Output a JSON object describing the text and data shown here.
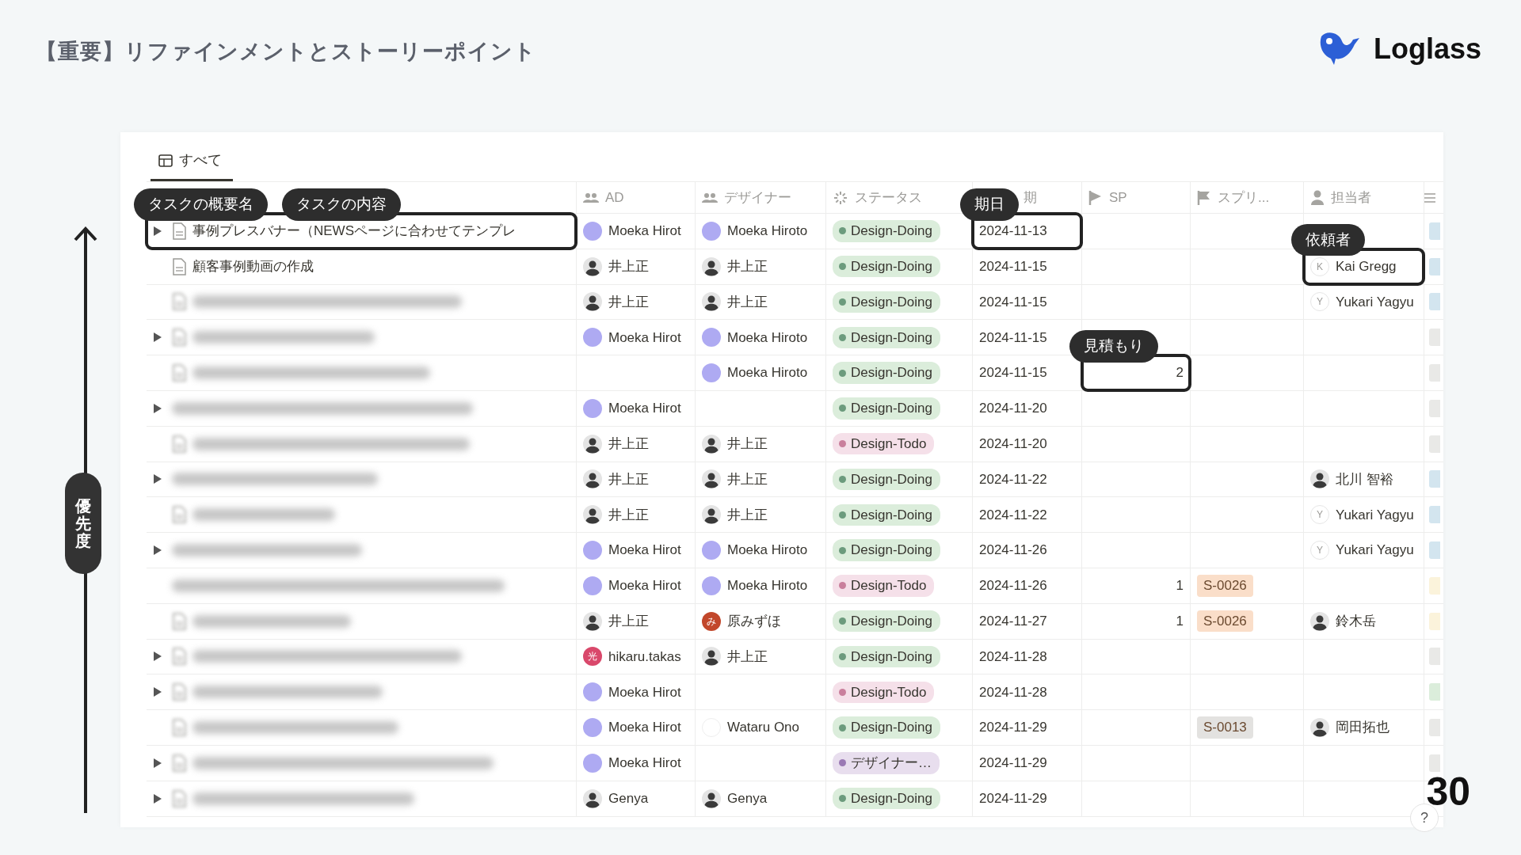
{
  "slide": {
    "title": "【重要】リファインメントとストーリーポイント",
    "brand": "Loglass",
    "page_number": "30"
  },
  "side_axis": {
    "label": "優先度"
  },
  "view_tab": {
    "label": "すべて",
    "selected": true
  },
  "help_button": {
    "label": "?"
  },
  "columns": [
    {
      "label": "AD"
    },
    {
      "label": "デザイナー"
    },
    {
      "label": "ステータス"
    },
    {
      "label": "期"
    },
    {
      "label": "SP"
    },
    {
      "label": "スプリ..."
    },
    {
      "label": "担当者"
    }
  ],
  "rows": [
    {
      "expandable": true,
      "page_icon": true,
      "name": "事例プレスバナー（NEWSページに合わせてテンプレ",
      "ad": {
        "name": "Moeka Hirot",
        "avatar": {
          "kind": "circle",
          "color": "#aeaaf2"
        }
      },
      "designer": {
        "name": "Moeka Hiroto",
        "avatar": {
          "kind": "circle",
          "color": "#aeaaf2"
        }
      },
      "status": {
        "label": "Design-Doing",
        "kind": "doing"
      },
      "date": "2024-11-13",
      "tag": {
        "color": "#d3e5ef"
      },
      "name_callouts": [
        "タスクの概要名",
        "タスクの内容"
      ],
      "date_callouts": [
        "期日"
      ]
    },
    {
      "expandable": false,
      "page_icon": true,
      "name": "顧客事例動画の作成",
      "ad": {
        "name": "井上正",
        "avatar": {
          "kind": "photo"
        }
      },
      "designer": {
        "name": "井上正",
        "avatar": {
          "kind": "photo"
        }
      },
      "status": {
        "label": "Design-Doing",
        "kind": "doing"
      },
      "date": "2024-11-15",
      "assignee": {
        "name": "Kai Gregg",
        "avatar": {
          "kind": "letter",
          "letter": "K",
          "color": "#ffffff"
        }
      },
      "tag": {
        "color": "#d3e5ef"
      },
      "assignee_callouts": [
        "依頼者"
      ]
    },
    {
      "expandable": false,
      "page_icon": true,
      "ad": {
        "name": "井上正",
        "avatar": {
          "kind": "photo"
        }
      },
      "designer": {
        "name": "井上正",
        "avatar": {
          "kind": "photo"
        }
      },
      "status": {
        "label": "Design-Doing",
        "kind": "doing"
      },
      "date": "2024-11-15",
      "assignee": {
        "name": "Yukari Yagyu",
        "avatar": {
          "kind": "letter",
          "letter": "Y",
          "color": "#ffffff"
        }
      },
      "tag": {
        "color": "#d3e5ef"
      }
    },
    {
      "expandable": true,
      "page_icon": true,
      "ad": {
        "name": "Moeka Hirot",
        "avatar": {
          "kind": "circle",
          "color": "#aeaaf2"
        }
      },
      "designer": {
        "name": "Moeka Hiroto",
        "avatar": {
          "kind": "circle",
          "color": "#aeaaf2"
        }
      },
      "status": {
        "label": "Design-Doing",
        "kind": "doing"
      },
      "date": "2024-11-15",
      "tag": {
        "color": "#e9e9e7"
      }
    },
    {
      "expandable": false,
      "page_icon": true,
      "designer": {
        "name": "Moeka Hiroto",
        "avatar": {
          "kind": "circle",
          "color": "#aeaaf2"
        }
      },
      "status": {
        "label": "Design-Doing",
        "kind": "doing"
      },
      "date": "2024-11-15",
      "sp": "2",
      "tag": {
        "color": "#e9e9e7"
      },
      "sp_callouts": [
        "見積もり"
      ]
    },
    {
      "expandable": true,
      "page_icon": false,
      "ad": {
        "name": "Moeka Hirot",
        "avatar": {
          "kind": "circle",
          "color": "#aeaaf2"
        }
      },
      "status": {
        "label": "Design-Doing",
        "kind": "doing"
      },
      "date": "2024-11-20",
      "tag": {
        "color": "#e9e9e7"
      }
    },
    {
      "expandable": false,
      "page_icon": true,
      "ad": {
        "name": "井上正",
        "avatar": {
          "kind": "photo"
        }
      },
      "designer": {
        "name": "井上正",
        "avatar": {
          "kind": "photo"
        }
      },
      "status": {
        "label": "Design-Todo",
        "kind": "todo"
      },
      "date": "2024-11-20",
      "tag": {
        "color": "#e9e9e7"
      }
    },
    {
      "expandable": true,
      "page_icon": false,
      "ad": {
        "name": "井上正",
        "avatar": {
          "kind": "photo"
        }
      },
      "designer": {
        "name": "井上正",
        "avatar": {
          "kind": "photo"
        }
      },
      "status": {
        "label": "Design-Doing",
        "kind": "doing"
      },
      "date": "2024-11-22",
      "assignee": {
        "name": "北川 智裕",
        "avatar": {
          "kind": "photo"
        }
      },
      "tag": {
        "color": "#d3e5ef"
      }
    },
    {
      "expandable": false,
      "page_icon": true,
      "ad": {
        "name": "井上正",
        "avatar": {
          "kind": "photo"
        }
      },
      "designer": {
        "name": "井上正",
        "avatar": {
          "kind": "photo"
        }
      },
      "status": {
        "label": "Design-Doing",
        "kind": "doing"
      },
      "date": "2024-11-22",
      "assignee": {
        "name": "Yukari Yagyu",
        "avatar": {
          "kind": "letter",
          "letter": "Y",
          "color": "#ffffff"
        }
      },
      "tag": {
        "color": "#d3e5ef"
      }
    },
    {
      "expandable": true,
      "page_icon": false,
      "ad": {
        "name": "Moeka Hirot",
        "avatar": {
          "kind": "circle",
          "color": "#aeaaf2"
        }
      },
      "designer": {
        "name": "Moeka Hiroto",
        "avatar": {
          "kind": "circle",
          "color": "#aeaaf2"
        }
      },
      "status": {
        "label": "Design-Doing",
        "kind": "doing"
      },
      "date": "2024-11-26",
      "assignee": {
        "name": "Yukari Yagyu",
        "avatar": {
          "kind": "letter",
          "letter": "Y",
          "color": "#ffffff"
        }
      },
      "tag": {
        "color": "#d3e5ef"
      }
    },
    {
      "expandable": false,
      "page_icon": false,
      "ad": {
        "name": "Moeka Hirot",
        "avatar": {
          "kind": "circle",
          "color": "#aeaaf2"
        }
      },
      "designer": {
        "name": "Moeka Hiroto",
        "avatar": {
          "kind": "circle",
          "color": "#aeaaf2"
        }
      },
      "status": {
        "label": "Design-Todo",
        "kind": "todo"
      },
      "date": "2024-11-26",
      "sp": "1",
      "sprint": {
        "label": "S-0026",
        "color": "#fadec9"
      },
      "tag": {
        "color": "#fbf3db"
      }
    },
    {
      "expandable": false,
      "page_icon": true,
      "ad": {
        "name": "井上正",
        "avatar": {
          "kind": "photo"
        }
      },
      "designer": {
        "name": "原みずほ",
        "avatar": {
          "kind": "letter",
          "letter": "み",
          "color": "#c2472b"
        }
      },
      "status": {
        "label": "Design-Doing",
        "kind": "doing"
      },
      "date": "2024-11-27",
      "sp": "1",
      "sprint": {
        "label": "S-0026",
        "color": "#fadec9"
      },
      "assignee": {
        "name": "鈴木岳",
        "avatar": {
          "kind": "photo"
        }
      },
      "tag": {
        "color": "#fbf3db"
      }
    },
    {
      "expandable": true,
      "page_icon": true,
      "ad": {
        "name": "hikaru.takas",
        "avatar": {
          "kind": "letter",
          "letter": "光",
          "color": "#d9486b"
        }
      },
      "designer": {
        "name": "井上正",
        "avatar": {
          "kind": "photo"
        }
      },
      "status": {
        "label": "Design-Doing",
        "kind": "doing"
      },
      "date": "2024-11-28",
      "tag": {
        "color": "#e9e9e7"
      }
    },
    {
      "expandable": true,
      "page_icon": true,
      "ad": {
        "name": "Moeka Hirot",
        "avatar": {
          "kind": "circle",
          "color": "#aeaaf2"
        }
      },
      "status": {
        "label": "Design-Todo",
        "kind": "todo"
      },
      "date": "2024-11-28",
      "tag": {
        "color": "#dbeddb"
      }
    },
    {
      "expandable": false,
      "page_icon": true,
      "ad": {
        "name": "Moeka Hirot",
        "avatar": {
          "kind": "circle",
          "color": "#aeaaf2"
        }
      },
      "designer": {
        "name": "Wataru Ono",
        "avatar": {
          "kind": "circle",
          "color": "#ffffff"
        }
      },
      "status": {
        "label": "Design-Doing",
        "kind": "doing"
      },
      "date": "2024-11-29",
      "sprint": {
        "label": "S-0013",
        "color": "#e3e2e0"
      },
      "assignee": {
        "name": "岡田拓也",
        "avatar": {
          "kind": "photo"
        }
      },
      "tag": {
        "color": "#e9e9e7"
      }
    },
    {
      "expandable": true,
      "page_icon": true,
      "ad": {
        "name": "Moeka Hirot",
        "avatar": {
          "kind": "circle",
          "color": "#aeaaf2"
        }
      },
      "status": {
        "label": "デザイナー…",
        "kind": "other"
      },
      "date": "2024-11-29",
      "tag": {
        "color": "#e9e9e7"
      }
    },
    {
      "expandable": true,
      "page_icon": true,
      "ad": {
        "name": "Genya",
        "avatar": {
          "kind": "photo"
        }
      },
      "designer": {
        "name": "Genya",
        "avatar": {
          "kind": "photo"
        }
      },
      "status": {
        "label": "Design-Doing",
        "kind": "doing"
      },
      "date": "2024-11-29"
    }
  ]
}
